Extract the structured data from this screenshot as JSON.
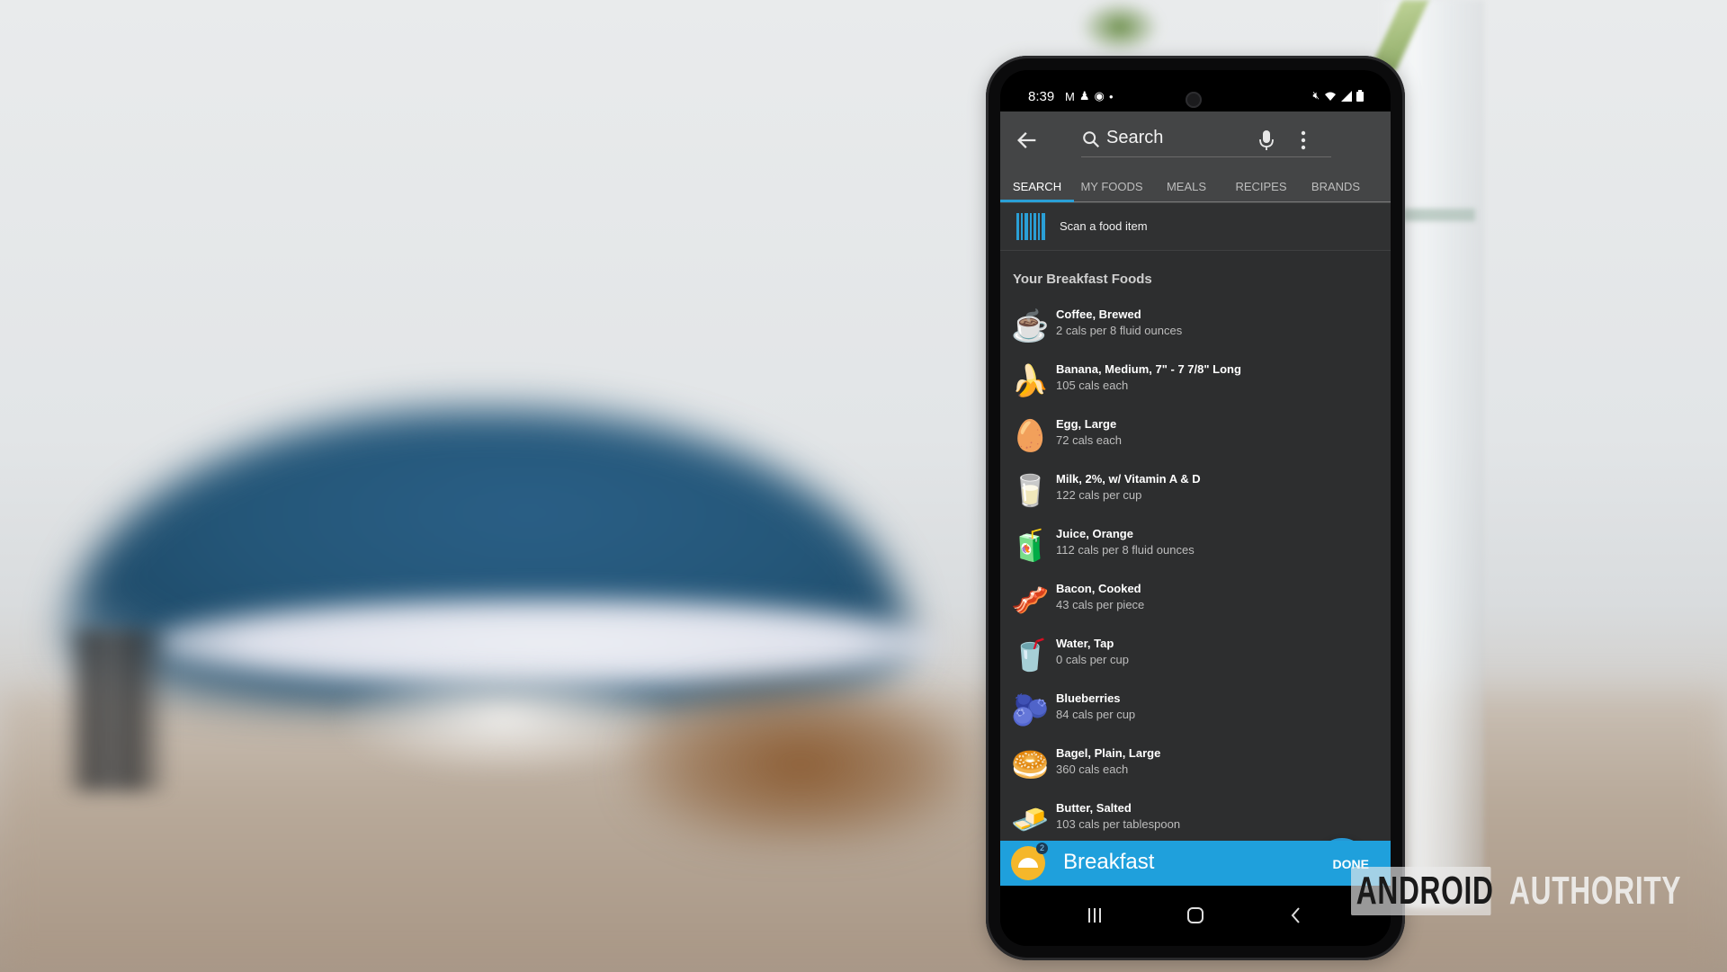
{
  "status_bar": {
    "time": "8:39",
    "left_icons": [
      "gmail-icon",
      "notification-icon",
      "sync-icon",
      "dot-icon"
    ],
    "right_icons": [
      "mute-icon",
      "wifi-icon",
      "signal-icon",
      "battery-icon"
    ]
  },
  "app_bar": {
    "search_placeholder": "Search",
    "tabs": [
      {
        "label": "SEARCH",
        "active": true
      },
      {
        "label": "MY FOODS",
        "active": false
      },
      {
        "label": "MEALS",
        "active": false
      },
      {
        "label": "RECIPES",
        "active": false
      },
      {
        "label": "BRANDS",
        "active": false
      }
    ]
  },
  "scan": {
    "label": "Scan a food item"
  },
  "section_header": "Your Breakfast Foods",
  "foods": [
    {
      "name": "Coffee, Brewed",
      "cals": "2 cals per 8 fluid ounces",
      "icon": "☕",
      "icon_name": "coffee-icon"
    },
    {
      "name": "Banana, Medium, 7\" - 7 7/8\" Long",
      "cals": "105 cals each",
      "icon": "🍌",
      "icon_name": "banana-icon"
    },
    {
      "name": "Egg, Large",
      "cals": "72 cals each",
      "icon": "🥚",
      "icon_name": "egg-icon"
    },
    {
      "name": "Milk, 2%, w/ Vitamin A & D",
      "cals": "122 cals per cup",
      "icon": "🥛",
      "icon_name": "milk-icon"
    },
    {
      "name": "Juice, Orange",
      "cals": "112 cals per 8 fluid ounces",
      "icon": "🧃",
      "icon_name": "juice-icon"
    },
    {
      "name": "Bacon, Cooked",
      "cals": "43 cals per piece",
      "icon": "🥓",
      "icon_name": "bacon-icon"
    },
    {
      "name": "Water, Tap",
      "cals": "0 cals per cup",
      "icon": "🥤",
      "icon_name": "water-icon"
    },
    {
      "name": "Blueberries",
      "cals": "84 cals per cup",
      "icon": "🫐",
      "icon_name": "blueberries-icon"
    },
    {
      "name": "Bagel, Plain, Large",
      "cals": "360 cals each",
      "icon": "🥯",
      "icon_name": "bagel-icon"
    },
    {
      "name": "Butter, Salted",
      "cals": "103 cals per tablespoon",
      "icon": "🧈",
      "icon_name": "butter-icon"
    }
  ],
  "meal_bar": {
    "meal": "Breakfast",
    "badge_count": "2",
    "done_label": "DONE"
  },
  "watermark": {
    "part1": "ANDROID",
    "part2": "AUTHORITY"
  },
  "colors": {
    "accent": "#1fa0dc",
    "fab": "#2596d3",
    "meal_icon": "#f5b72a",
    "app_bar": "#444546",
    "list_bg": "#2d2e2f"
  }
}
